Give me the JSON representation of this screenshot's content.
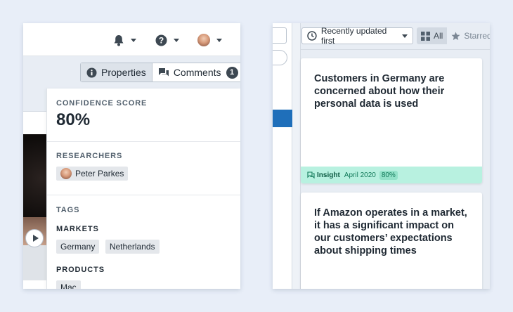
{
  "left_panel": {
    "toolbar": {
      "properties_label": "Properties",
      "comments_label": "Comments",
      "comments_count": "1"
    },
    "properties": {
      "confidence": {
        "label": "CONFIDENCE SCORE",
        "value": "80%"
      },
      "researchers": {
        "label": "RESEARCHERS",
        "items": [
          "Peter Parkes"
        ]
      },
      "tags": {
        "label": "TAGS",
        "markets": {
          "label": "MARKETS",
          "items": [
            "Germany",
            "Netherlands"
          ]
        },
        "products": {
          "label": "PRODUCTS",
          "items": [
            "Mac"
          ]
        }
      }
    }
  },
  "right_panel": {
    "sort_label": "Recently updated first",
    "filters": {
      "all": "All",
      "starred": "Starred"
    },
    "cards": [
      {
        "title": "Customers in Germany are concerned about how their personal data is used",
        "type": "Insight",
        "date": "April 2020",
        "confidence": "80%"
      },
      {
        "title": "If Amazon operates in a market, it has a significant impact on our customers’ expectations about shipping times"
      }
    ]
  },
  "icons": {
    "notifications": "bell-icon",
    "help": "question-icon",
    "info": "info-icon",
    "comments": "comments-icon",
    "sort": "clock-icon",
    "grid": "grid-icon",
    "star": "star-icon",
    "insight": "insight-icon",
    "play": "play-icon"
  },
  "colors": {
    "insight_bg": "#b8f1e0",
    "selected_blue": "#1f6fba",
    "badge": "#3d4852"
  }
}
